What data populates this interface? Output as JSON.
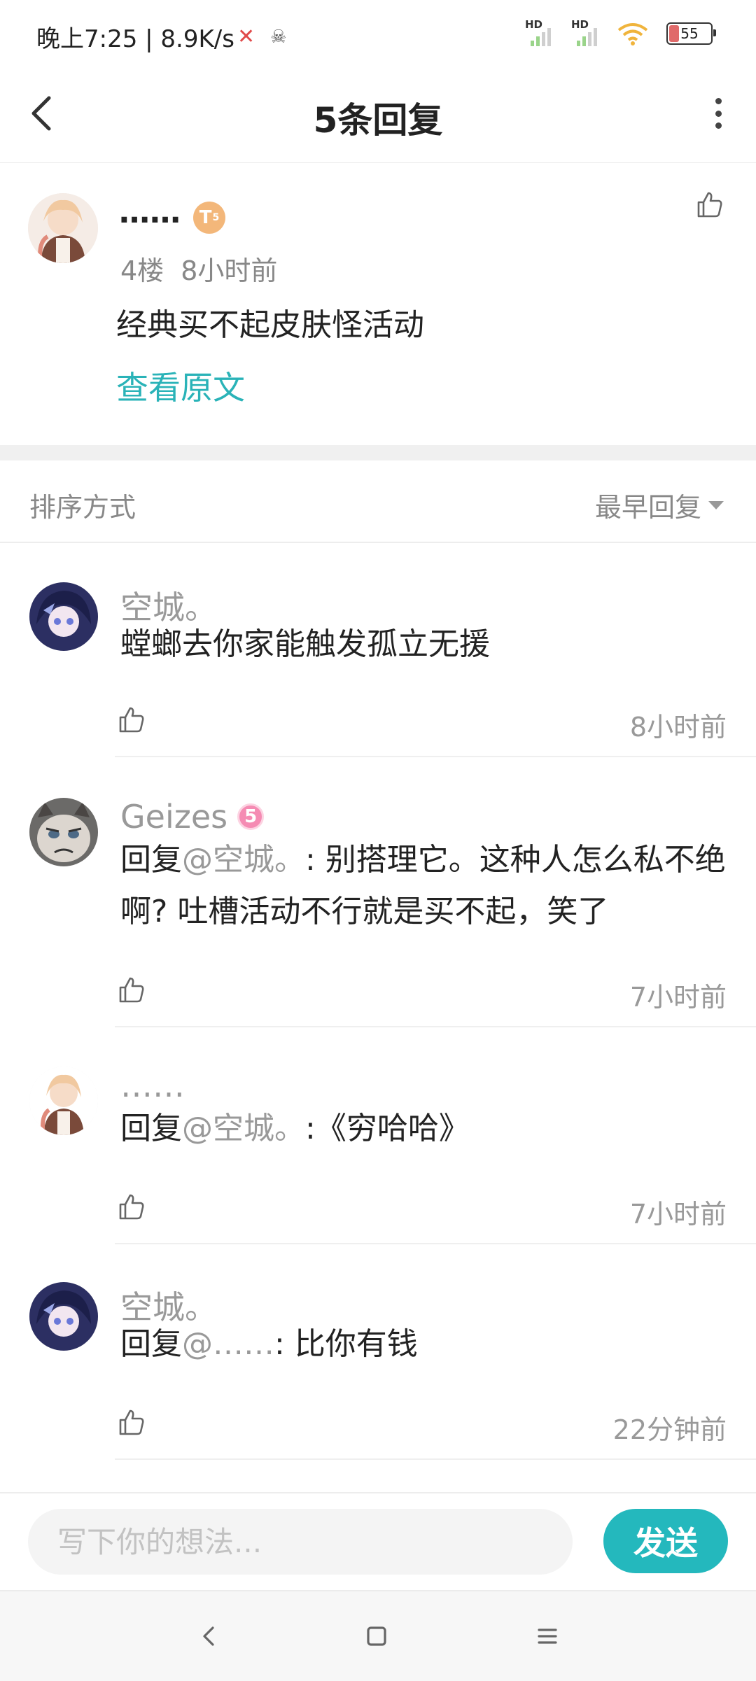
{
  "status_bar": {
    "time_speed": "晚上7:25 | 8.9K/s",
    "extra_icon": "☠",
    "battery": "55",
    "signal_label": "HD"
  },
  "header": {
    "title": "5条回复"
  },
  "post": {
    "author": "……",
    "badge": "T",
    "badge_sub": "5",
    "floor": "4楼",
    "time": "8小时前",
    "content": "经典买不起皮肤怪活动",
    "view_original": "查看原文"
  },
  "sort": {
    "label": "排序方式",
    "value": "最早回复"
  },
  "replies": [
    {
      "author": "空城。",
      "text": "螳螂去你家能触发孤立无援",
      "time": "8小时前"
    },
    {
      "author": "Geizes",
      "badge": "5",
      "reply_prefix": "回复",
      "mention": "@空城。",
      "text": ": 别搭理它。这种人怎么私不绝啊? 吐槽活动不行就是买不起，笑了",
      "time": "7小时前"
    },
    {
      "author": "……",
      "reply_prefix": "回复",
      "mention": "@空城。",
      "text": ":《穷哈哈》",
      "time": "7小时前"
    },
    {
      "author": "空城。",
      "reply_prefix": "回复",
      "mention": "@……",
      "text": ": 比你有钱",
      "time": "22分钟前"
    }
  ],
  "composer": {
    "placeholder": "写下你的想法...",
    "send_label": "发送"
  },
  "colors": {
    "accent": "#24b8bd",
    "link": "#2ab3b8",
    "muted": "#999999"
  }
}
